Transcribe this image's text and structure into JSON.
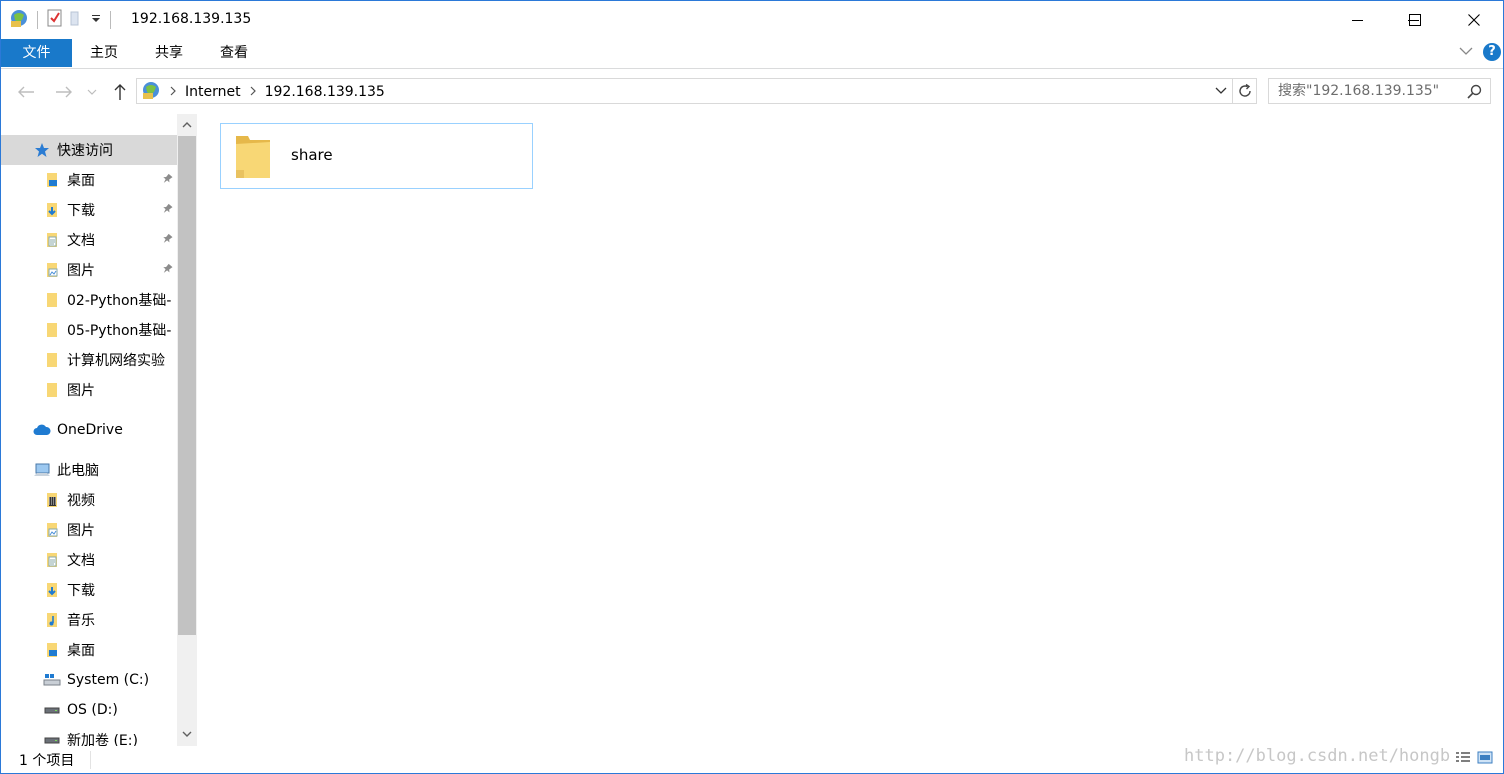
{
  "window": {
    "title": "192.168.139.135"
  },
  "ribbon": {
    "tabs": [
      "文件",
      "主页",
      "共享",
      "查看"
    ],
    "help_label": "?"
  },
  "address": {
    "crumbs": [
      "Internet",
      "192.168.139.135"
    ],
    "search_placeholder": "搜索\"192.168.139.135\""
  },
  "nav": {
    "quick_access": "快速访问",
    "quick_items": [
      {
        "label": "桌面",
        "pinned": true
      },
      {
        "label": "下载",
        "pinned": true
      },
      {
        "label": "文档",
        "pinned": true
      },
      {
        "label": "图片",
        "pinned": true
      },
      {
        "label": "02-Python基础-",
        "pinned": false
      },
      {
        "label": "05-Python基础-",
        "pinned": false
      },
      {
        "label": "计算机网络实验",
        "pinned": false
      },
      {
        "label": "图片",
        "pinned": false
      }
    ],
    "onedrive": "OneDrive",
    "this_pc": "此电脑",
    "pc_items": [
      {
        "label": "视频"
      },
      {
        "label": "图片"
      },
      {
        "label": "文档"
      },
      {
        "label": "下载"
      },
      {
        "label": "音乐"
      },
      {
        "label": "桌面"
      },
      {
        "label": "System (C:)"
      },
      {
        "label": "OS (D:)"
      },
      {
        "label": "新加卷 (E:)"
      }
    ]
  },
  "content": {
    "items": [
      {
        "name": "share",
        "type": "folder"
      }
    ]
  },
  "status": {
    "count_text": "1 个项目",
    "watermark": "http://blog.csdn.net/hongb"
  },
  "colors": {
    "accent": "#1979ca",
    "selection": "#d9d9d9",
    "tile_border": "#99d1ff",
    "folder": "#f8d775"
  }
}
